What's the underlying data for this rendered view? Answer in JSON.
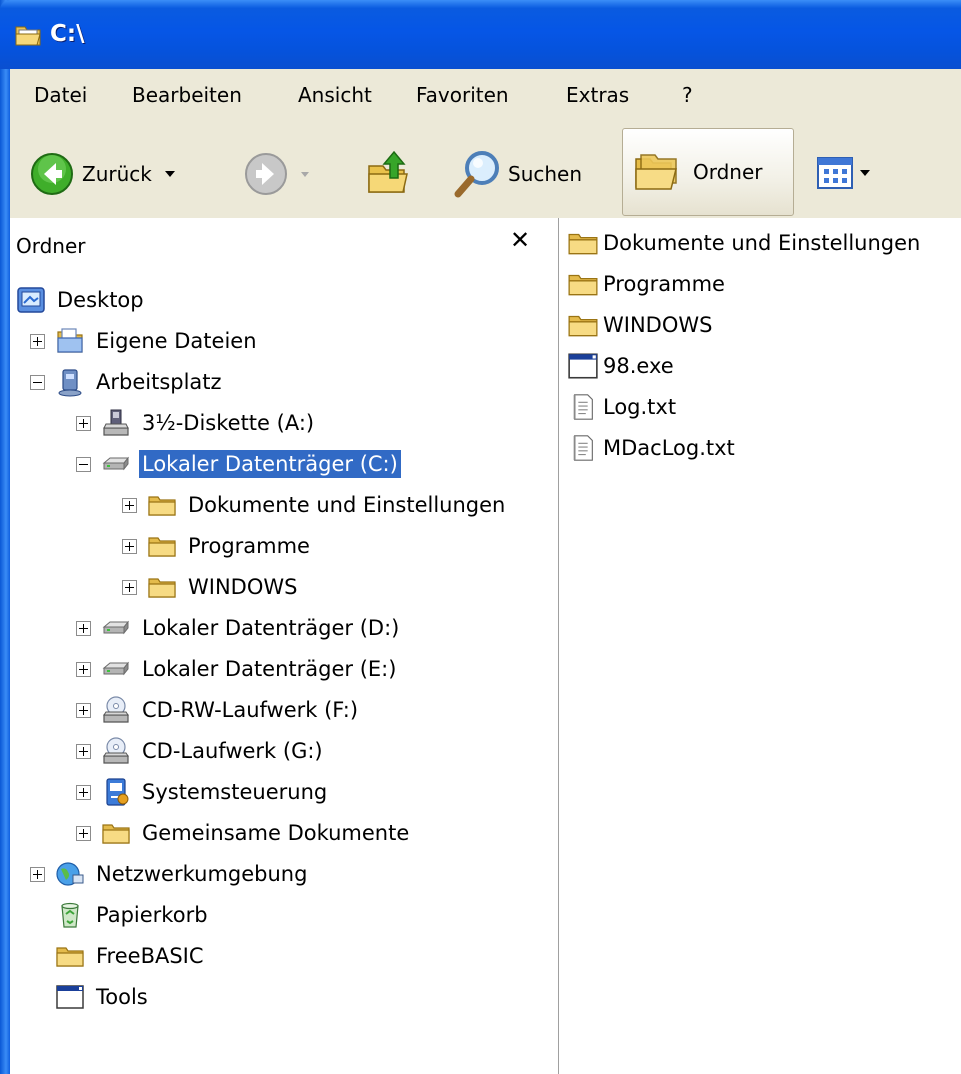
{
  "window": {
    "title": "C:\\"
  },
  "menu": [
    "Datei",
    "Bearbeiten",
    "Ansicht",
    "Favoriten",
    "Extras",
    "?"
  ],
  "toolbar": {
    "back_label": "Zurück",
    "search_label": "Suchen",
    "folders_label": "Ordner"
  },
  "folders_pane": {
    "title": "Ordner",
    "close_glyph": "✕",
    "tree": [
      {
        "label": "Desktop",
        "icon": "desktop-icon",
        "level": 0,
        "expander": "none"
      },
      {
        "label": "Eigene Dateien",
        "icon": "my-documents-icon",
        "level": 1,
        "expander": "plus"
      },
      {
        "label": "Arbeitsplatz",
        "icon": "my-computer-icon",
        "level": 1,
        "expander": "minus"
      },
      {
        "label": "3½-Diskette (A:)",
        "icon": "floppy-drive-icon",
        "level": 2,
        "expander": "plus"
      },
      {
        "label": "Lokaler Datenträger (C:)",
        "icon": "hard-drive-icon",
        "level": 2,
        "expander": "minus",
        "selected": true
      },
      {
        "label": "Dokumente und Einstellungen",
        "icon": "folder-icon",
        "level": 3,
        "expander": "plus"
      },
      {
        "label": "Programme",
        "icon": "folder-icon",
        "level": 3,
        "expander": "plus"
      },
      {
        "label": "WINDOWS",
        "icon": "folder-icon",
        "level": 3,
        "expander": "plus"
      },
      {
        "label": "Lokaler Datenträger (D:)",
        "icon": "hard-drive-icon",
        "level": 2,
        "expander": "plus"
      },
      {
        "label": "Lokaler Datenträger (E:)",
        "icon": "hard-drive-icon",
        "level": 2,
        "expander": "plus"
      },
      {
        "label": "CD-RW-Laufwerk (F:)",
        "icon": "cd-drive-icon",
        "level": 2,
        "expander": "plus"
      },
      {
        "label": "CD-Laufwerk (G:)",
        "icon": "cd-drive-icon",
        "level": 2,
        "expander": "plus"
      },
      {
        "label": "Systemsteuerung",
        "icon": "control-panel-icon",
        "level": 2,
        "expander": "plus"
      },
      {
        "label": "Gemeinsame Dokumente",
        "icon": "folder-icon",
        "level": 2,
        "expander": "plus"
      },
      {
        "label": "Netzwerkumgebung",
        "icon": "network-icon",
        "level": 1,
        "expander": "plus"
      },
      {
        "label": "Papierkorb",
        "icon": "recycle-bin-icon",
        "level": 1,
        "expander": "none"
      },
      {
        "label": "FreeBASIC",
        "icon": "folder-icon",
        "level": 1,
        "expander": "none"
      },
      {
        "label": "Tools",
        "icon": "program-window-icon",
        "level": 1,
        "expander": "none"
      }
    ]
  },
  "files": [
    {
      "name": "Dokumente und Einstellungen",
      "icon": "folder-icon"
    },
    {
      "name": "Programme",
      "icon": "folder-icon"
    },
    {
      "name": "WINDOWS",
      "icon": "folder-icon"
    },
    {
      "name": "98.exe",
      "icon": "program-window-icon"
    },
    {
      "name": "Log.txt",
      "icon": "text-file-icon"
    },
    {
      "name": "MDacLog.txt",
      "icon": "text-file-icon"
    }
  ],
  "colors": {
    "titlebar": "#0656e6",
    "selection": "#316ac5",
    "chrome": "#ece9d8"
  }
}
